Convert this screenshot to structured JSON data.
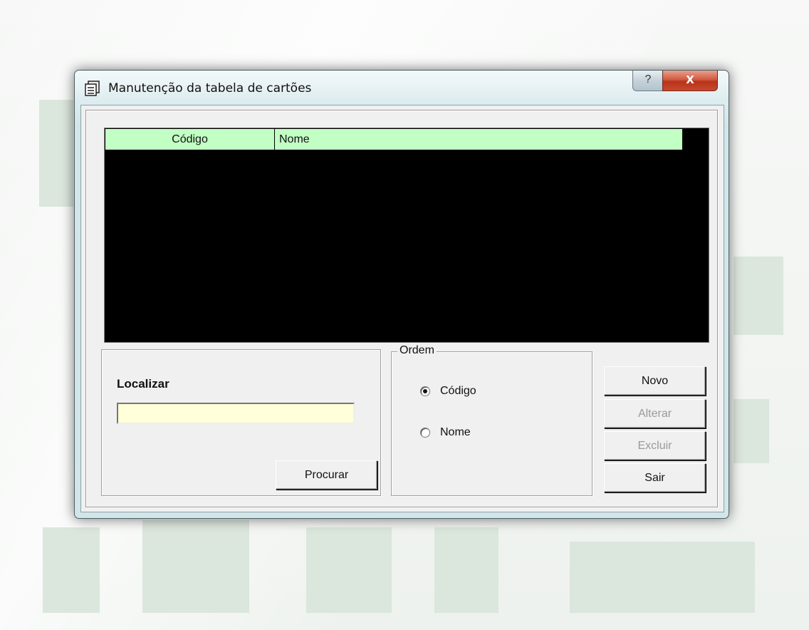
{
  "window": {
    "title": "Manutenção da tabela de cartões",
    "help_label": "?",
    "close_label": "X"
  },
  "grid": {
    "columns": [
      "Código",
      "Nome"
    ],
    "rows": []
  },
  "search": {
    "label": "Localizar",
    "value": "",
    "button_label": "Procurar"
  },
  "order": {
    "legend": "Ordem",
    "options": [
      {
        "label": "Código",
        "checked": true
      },
      {
        "label": "Nome",
        "checked": false
      }
    ]
  },
  "actions": {
    "novo": "Novo",
    "alterar": "Alterar",
    "excluir": "Excluir",
    "sair": "Sair"
  }
}
